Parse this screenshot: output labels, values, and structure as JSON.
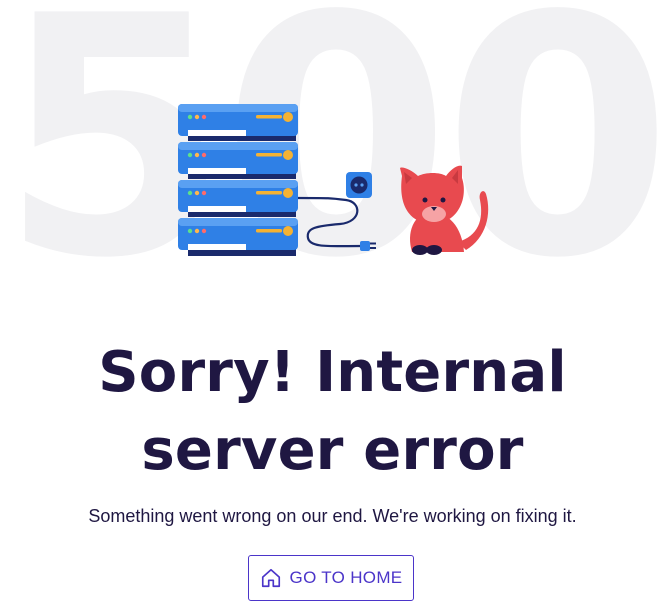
{
  "illustration": {
    "background_code": "500",
    "icons": [
      "server-rack-icon",
      "power-socket-icon",
      "unplugged-cable-icon",
      "cat-icon"
    ]
  },
  "error": {
    "title": "Sorry! Internal server error",
    "message": "Something went wrong on our end. We're working on fixing it."
  },
  "actions": {
    "home_label": "GO TO HOME",
    "home_icon": "home-icon"
  },
  "colors": {
    "title": "#1f1742",
    "accent": "#4b35c9",
    "server_blue": "#2f80e6",
    "cat_red": "#e84a4f"
  }
}
